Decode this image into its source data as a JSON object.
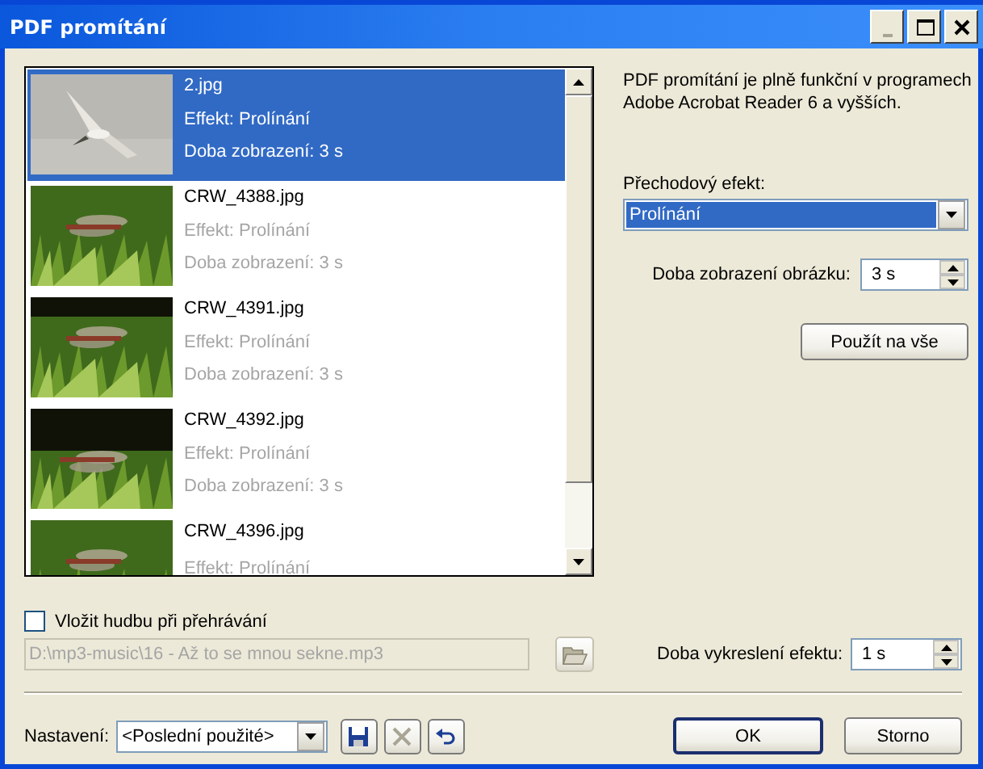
{
  "window": {
    "title": "PDF promítání",
    "controls": [
      {
        "kind": "minimize",
        "disabled": true
      },
      {
        "kind": "maximize",
        "disabled": false
      },
      {
        "kind": "close",
        "disabled": false
      }
    ]
  },
  "slides": [
    {
      "file": "2.jpg",
      "effect": "Effekt: Prolínání",
      "duration": "Doba zobrazení: 3 s",
      "selected": true
    },
    {
      "file": "CRW_4388.jpg",
      "effect": "Effekt: Prolínání",
      "duration": "Doba zobrazení: 3 s",
      "selected": false
    },
    {
      "file": "CRW_4391.jpg",
      "effect": "Effekt: Prolínání",
      "duration": "Doba zobrazení: 3 s",
      "selected": false
    },
    {
      "file": "CRW_4392.jpg",
      "effect": "Effekt: Prolínání",
      "duration": "Doba zobrazení: 3 s",
      "selected": false
    },
    {
      "file": "CRW_4396.jpg",
      "effect": "Effekt: Prolínání",
      "selected": false
    }
  ],
  "info": "PDF promítání je plně funkční v programech Adobe Acrobat Reader 6 a vyšších.",
  "transition": {
    "label": "Přechodový efekt:",
    "value": "Prolínání"
  },
  "display_time": {
    "label": "Doba zobrazení obrázku:",
    "value": "3 s"
  },
  "apply_all_button": "Použít na vše",
  "music": {
    "label": "Vložit hudbu při přehrávání",
    "checked": false,
    "path": "D:\\mp3-music\\16 - Až to se mnou sekne.mp3",
    "disabled": true
  },
  "effect_time": {
    "label": "Doba vykreslení efektu:",
    "value": "1 s"
  },
  "preset": {
    "label": "Nastavení:",
    "value": "<Poslední použité>"
  },
  "preset_actions": [
    {
      "kind": "save",
      "disabled": false
    },
    {
      "kind": "delete",
      "disabled": true
    },
    {
      "kind": "undo",
      "disabled": false
    }
  ],
  "buttons": [
    {
      "label": "OK",
      "default": true
    },
    {
      "label": "Storno",
      "default": false
    }
  ]
}
